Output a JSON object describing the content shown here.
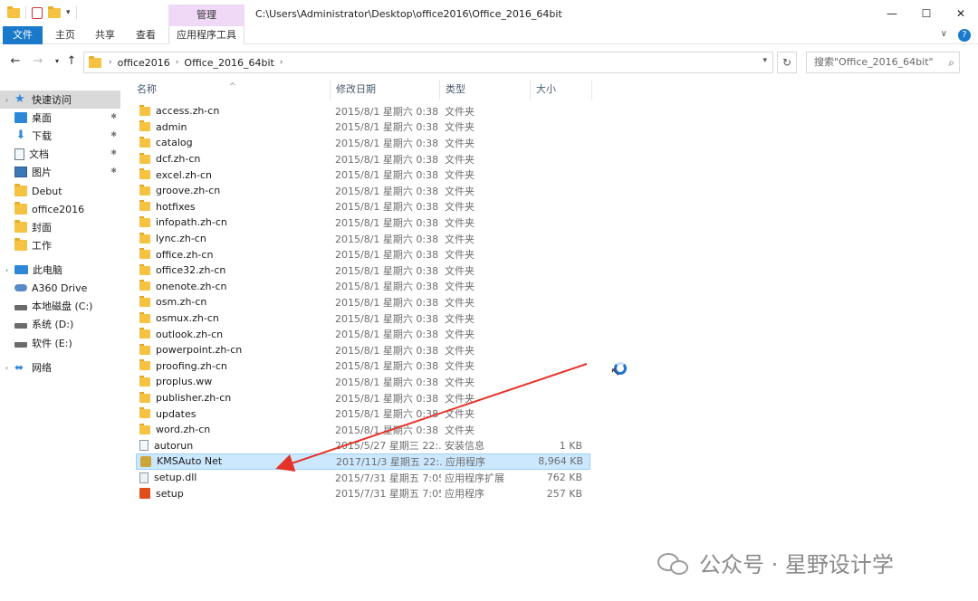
{
  "titlebar": {
    "context_tab_header": "管理",
    "path": "C:\\Users\\Administrator\\Desktop\\office2016\\Office_2016_64bit",
    "minimize": "—",
    "maximize": "☐",
    "close": "✕"
  },
  "ribbon": {
    "tabs": [
      "文件",
      "主页",
      "共享",
      "查看",
      "应用程序工具"
    ]
  },
  "nav": {
    "breadcrumbs": [
      "office2016",
      "Office_2016_64bit"
    ],
    "search_placeholder": "搜索\"Office_2016_64bit\""
  },
  "sidebar": {
    "items": [
      {
        "label": "快速访问",
        "icon": "star-icon"
      },
      {
        "label": "桌面",
        "icon": "desktop-icon"
      },
      {
        "label": "下载",
        "icon": "download-icon"
      },
      {
        "label": "文档",
        "icon": "document-icon"
      },
      {
        "label": "图片",
        "icon": "pictures-icon"
      },
      {
        "label": "Debut",
        "icon": "folder-icon"
      },
      {
        "label": "office2016",
        "icon": "folder-icon"
      },
      {
        "label": "封面",
        "icon": "folder-icon"
      },
      {
        "label": "工作",
        "icon": "folder-icon"
      },
      {
        "label": "此电脑",
        "icon": "this-pc-icon"
      },
      {
        "label": "A360 Drive",
        "icon": "cloud-drive-icon"
      },
      {
        "label": "本地磁盘 (C:)",
        "icon": "drive-icon"
      },
      {
        "label": "系统 (D:)",
        "icon": "drive-icon"
      },
      {
        "label": "软件 (E:)",
        "icon": "drive-icon"
      },
      {
        "label": "网络",
        "icon": "network-icon"
      }
    ]
  },
  "columns": {
    "name": "名称",
    "date": "修改日期",
    "type": "类型",
    "size": "大小"
  },
  "files": [
    {
      "name": "access.zh-cn",
      "date": "2015/8/1 星期六 0:38",
      "type": "文件夹",
      "size": "",
      "icon": "folder"
    },
    {
      "name": "admin",
      "date": "2015/8/1 星期六 0:38",
      "type": "文件夹",
      "size": "",
      "icon": "folder"
    },
    {
      "name": "catalog",
      "date": "2015/8/1 星期六 0:38",
      "type": "文件夹",
      "size": "",
      "icon": "folder"
    },
    {
      "name": "dcf.zh-cn",
      "date": "2015/8/1 星期六 0:38",
      "type": "文件夹",
      "size": "",
      "icon": "folder"
    },
    {
      "name": "excel.zh-cn",
      "date": "2015/8/1 星期六 0:38",
      "type": "文件夹",
      "size": "",
      "icon": "folder"
    },
    {
      "name": "groove.zh-cn",
      "date": "2015/8/1 星期六 0:38",
      "type": "文件夹",
      "size": "",
      "icon": "folder"
    },
    {
      "name": "hotfixes",
      "date": "2015/8/1 星期六 0:38",
      "type": "文件夹",
      "size": "",
      "icon": "folder"
    },
    {
      "name": "infopath.zh-cn",
      "date": "2015/8/1 星期六 0:38",
      "type": "文件夹",
      "size": "",
      "icon": "folder"
    },
    {
      "name": "lync.zh-cn",
      "date": "2015/8/1 星期六 0:38",
      "type": "文件夹",
      "size": "",
      "icon": "folder"
    },
    {
      "name": "office.zh-cn",
      "date": "2015/8/1 星期六 0:38",
      "type": "文件夹",
      "size": "",
      "icon": "folder"
    },
    {
      "name": "office32.zh-cn",
      "date": "2015/8/1 星期六 0:38",
      "type": "文件夹",
      "size": "",
      "icon": "folder"
    },
    {
      "name": "onenote.zh-cn",
      "date": "2015/8/1 星期六 0:38",
      "type": "文件夹",
      "size": "",
      "icon": "folder"
    },
    {
      "name": "osm.zh-cn",
      "date": "2015/8/1 星期六 0:38",
      "type": "文件夹",
      "size": "",
      "icon": "folder"
    },
    {
      "name": "osmux.zh-cn",
      "date": "2015/8/1 星期六 0:38",
      "type": "文件夹",
      "size": "",
      "icon": "folder"
    },
    {
      "name": "outlook.zh-cn",
      "date": "2015/8/1 星期六 0:38",
      "type": "文件夹",
      "size": "",
      "icon": "folder"
    },
    {
      "name": "powerpoint.zh-cn",
      "date": "2015/8/1 星期六 0:38",
      "type": "文件夹",
      "size": "",
      "icon": "folder"
    },
    {
      "name": "proofing.zh-cn",
      "date": "2015/8/1 星期六 0:38",
      "type": "文件夹",
      "size": "",
      "icon": "folder"
    },
    {
      "name": "proplus.ww",
      "date": "2015/8/1 星期六 0:38",
      "type": "文件夹",
      "size": "",
      "icon": "folder"
    },
    {
      "name": "publisher.zh-cn",
      "date": "2015/8/1 星期六 0:38",
      "type": "文件夹",
      "size": "",
      "icon": "folder"
    },
    {
      "name": "updates",
      "date": "2015/8/1 星期六 0:38",
      "type": "文件夹",
      "size": "",
      "icon": "folder"
    },
    {
      "name": "word.zh-cn",
      "date": "2015/8/1 星期六 0:38",
      "type": "文件夹",
      "size": "",
      "icon": "folder"
    },
    {
      "name": "autorun",
      "date": "2015/5/27 星期三 22:...",
      "type": "安装信息",
      "size": "1 KB",
      "icon": "inf"
    },
    {
      "name": "KMSAuto Net",
      "date": "2017/11/3 星期五 22:...",
      "type": "应用程序",
      "size": "8,964 KB",
      "icon": "exe",
      "selected": true
    },
    {
      "name": "setup.dll",
      "date": "2015/7/31 星期五 7:05",
      "type": "应用程序扩展",
      "size": "762 KB",
      "icon": "dll"
    },
    {
      "name": "setup",
      "date": "2015/7/31 星期五 7:05",
      "type": "应用程序",
      "size": "257 KB",
      "icon": "office"
    }
  ],
  "watermark": "公众号 · 星野设计学",
  "colors": {
    "accent": "#1979ca",
    "selection": "#cce8ff",
    "arrow": "#e5332a",
    "folder": "#f5c242"
  }
}
